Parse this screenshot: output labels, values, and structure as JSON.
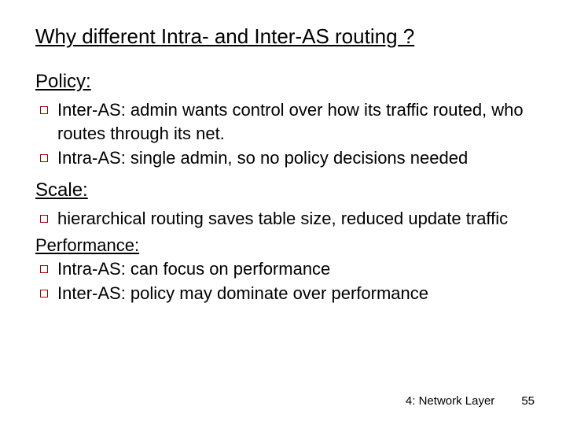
{
  "title": "Why different Intra- and Inter-AS routing ?",
  "sections": {
    "policy": {
      "heading": "Policy:",
      "bullets": [
        "Inter-AS: admin wants control over how its traffic routed, who routes through its net.",
        "Intra-AS: single admin, so no policy decisions needed"
      ]
    },
    "scale": {
      "heading": "Scale:",
      "bullets": [
        "hierarchical routing saves table size, reduced update traffic"
      ]
    },
    "performance": {
      "heading": "Performance:",
      "bullets": [
        "Intra-AS: can focus on performance",
        "Inter-AS: policy may dominate over performance"
      ]
    }
  },
  "footer": {
    "chapter": "4: Network Layer",
    "page": "55"
  }
}
